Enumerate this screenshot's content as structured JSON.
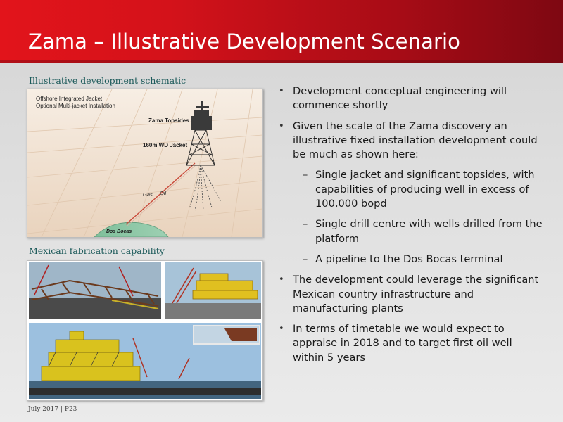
{
  "slide": {
    "title": "Zama – Illustrative Development Scenario",
    "footer": "July 2017 | P23"
  },
  "left": {
    "schematic_label": "Illustrative development schematic",
    "schematic": {
      "note_line1": "Offshore Integrated Jacket",
      "note_line2": "Optional Multi-jacket Installation",
      "topsides_label": "Zama Topsides",
      "jacket_label": "160m WD Jacket",
      "gas_label": "Gas",
      "oil_label": "Oil",
      "terminal_label": "Dos Bocas"
    },
    "fabrication_label": "Mexican fabrication capability"
  },
  "bullets": [
    {
      "level": 1,
      "text": "Development conceptual engineering will commence shortly"
    },
    {
      "level": 1,
      "text": "Given the scale of the Zama discovery an illustrative fixed installation development could be much as shown here:"
    },
    {
      "level": 2,
      "text": "Single jacket and significant topsides, with capabilities of producing well in excess of 100,000 bopd"
    },
    {
      "level": 2,
      "text": "Single drill centre with wells drilled from the platform"
    },
    {
      "level": 2,
      "text": "A pipeline to the Dos Bocas terminal"
    },
    {
      "level": 1,
      "text": "The development could leverage the significant Mexican country infrastructure and manufacturing plants"
    },
    {
      "level": 1,
      "text": "In terms of timetable we would expect to appraise in 2018 and to target first oil well within 5 years"
    }
  ],
  "colors": {
    "title_red": "#d4121a",
    "label_teal": "#1c5a5a"
  }
}
